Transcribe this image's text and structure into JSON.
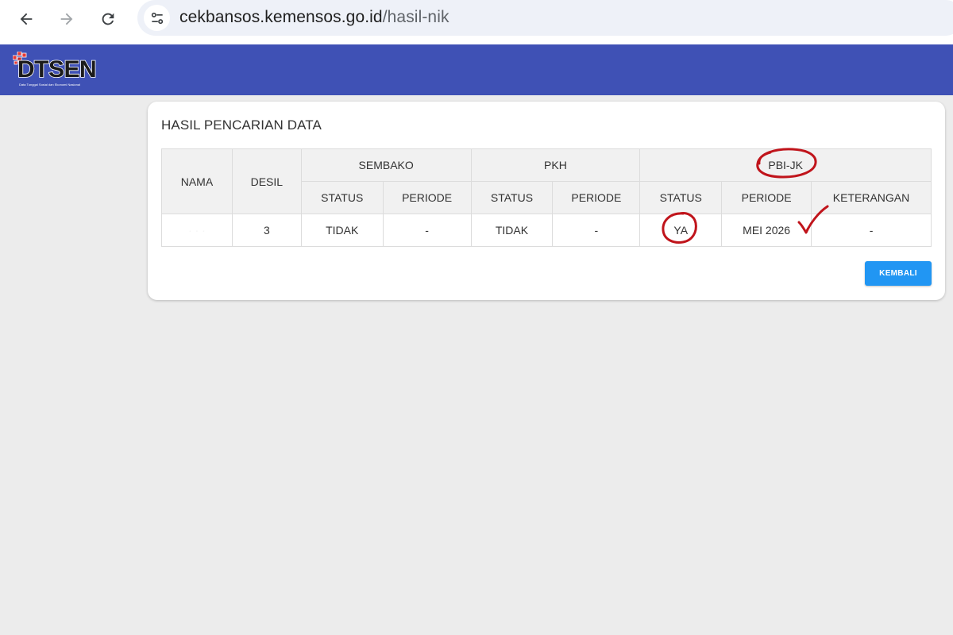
{
  "browser": {
    "url_domain": "cekbansos.kemensos.go.id",
    "url_path": "/hasil-nik",
    "back_icon": "arrow-left-icon",
    "forward_icon": "arrow-right-icon",
    "reload_icon": "reload-icon",
    "site_info_icon": "tune-icon"
  },
  "header": {
    "logo_text": "DTSEN",
    "logo_subtitle": "Data Tunggal Sosial dan Ekonomi Nasional",
    "brand_color": "#3f51b5"
  },
  "card": {
    "title": "HASIL PENCARIAN DATA",
    "table": {
      "group_headers": {
        "nama": "NAMA",
        "desil": "DESIL",
        "sembako": "SEMBAKO",
        "pkh": "PKH",
        "pbijk": "PBI-JK"
      },
      "sub_headers": {
        "sembako_status": "STATUS",
        "sembako_periode": "PERIODE",
        "pkh_status": "STATUS",
        "pkh_periode": "PERIODE",
        "pbijk_status": "STATUS",
        "pbijk_periode": "PERIODE",
        "pbijk_keterangan": "KETERANGAN"
      },
      "row": {
        "nama": "· · ·",
        "desil": "3",
        "sembako_status": "TIDAK",
        "sembako_periode": "-",
        "pkh_status": "TIDAK",
        "pkh_periode": "-",
        "pbijk_status": "YA",
        "pbijk_periode": "MEI 2026",
        "pbijk_keterangan": "-"
      }
    },
    "back_button": "KEMBALI",
    "button_color": "#2196f3"
  },
  "annotations": {
    "color": "#c0141b",
    "marks": [
      "circle-pbijk",
      "circle-ya",
      "checkmark-periode"
    ]
  }
}
